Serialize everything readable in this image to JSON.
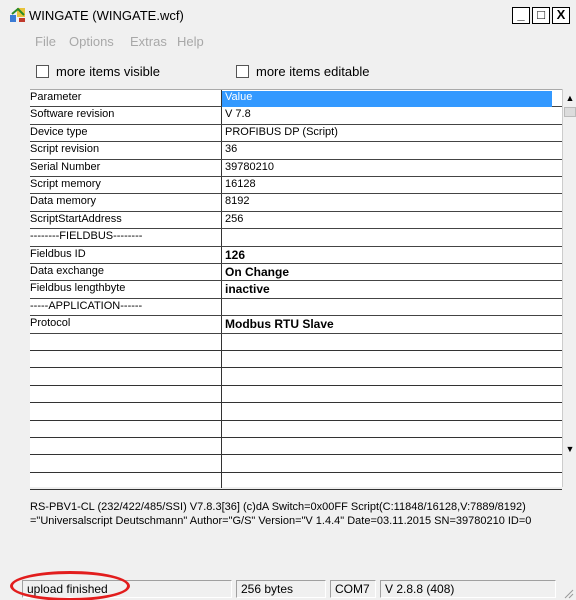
{
  "window": {
    "title": "WINGATE  (WINGATE.wcf)",
    "controls": {
      "minimize": "_",
      "maximize": "□",
      "close": "X"
    }
  },
  "menu": {
    "items": [
      "File",
      "Options",
      "Extras",
      "Help"
    ]
  },
  "checkboxes": [
    {
      "label": "more items visible",
      "checked": false
    },
    {
      "label": "more items editable",
      "checked": false
    }
  ],
  "grid": {
    "header": {
      "parameter": "Parameter",
      "value": "Value"
    },
    "rows": [
      {
        "parameter": "Software revision",
        "value": "V 7.8",
        "bold": false
      },
      {
        "parameter": "Device type",
        "value": "PROFIBUS DP (Script)",
        "bold": false
      },
      {
        "parameter": "Script revision",
        "value": "36",
        "bold": false
      },
      {
        "parameter": "Serial Number",
        "value": "39780210",
        "bold": false
      },
      {
        "parameter": "Script memory",
        "value": "16128",
        "bold": false
      },
      {
        "parameter": "Data memory",
        "value": "8192",
        "bold": false
      },
      {
        "parameter": "ScriptStartAddress",
        "value": "256",
        "bold": false
      },
      {
        "parameter": "--------FIELDBUS--------",
        "value": "",
        "bold": false
      },
      {
        "parameter": "Fieldbus ID",
        "value": "126",
        "bold": true
      },
      {
        "parameter": "Data exchange",
        "value": "On Change",
        "bold": true
      },
      {
        "parameter": "Fieldbus lengthbyte",
        "value": "inactive",
        "bold": true
      },
      {
        "parameter": "-----APPLICATION------",
        "value": "",
        "bold": false
      },
      {
        "parameter": "Protocol",
        "value": "Modbus RTU Slave",
        "bold": true
      }
    ],
    "empty_rows": 9
  },
  "info": {
    "line1": "RS-PBV1-CL (232/422/485/SSI) V7.8.3[36] (c)dA Switch=0x00FF Script(C:11848/16128,V:7889/8192)",
    "line2": "=\"Universalscript Deutschmann\" Author=\"G/S\" Version=\"V 1.4.4\" Date=03.11.2015 SN=39780210 ID=0"
  },
  "statusbar": {
    "message": "upload finished",
    "size": "256 bytes",
    "port": "COM7",
    "version": "V 2.8.8 (408)"
  },
  "colors": {
    "selection": "#3399ff",
    "highlight_ring": "#e21d1d",
    "menu_disabled": "#a8a8a8"
  },
  "icons": [
    "wingate-app-icon",
    "scroll-up-icon",
    "scroll-down-icon",
    "resize-grip-icon"
  ]
}
